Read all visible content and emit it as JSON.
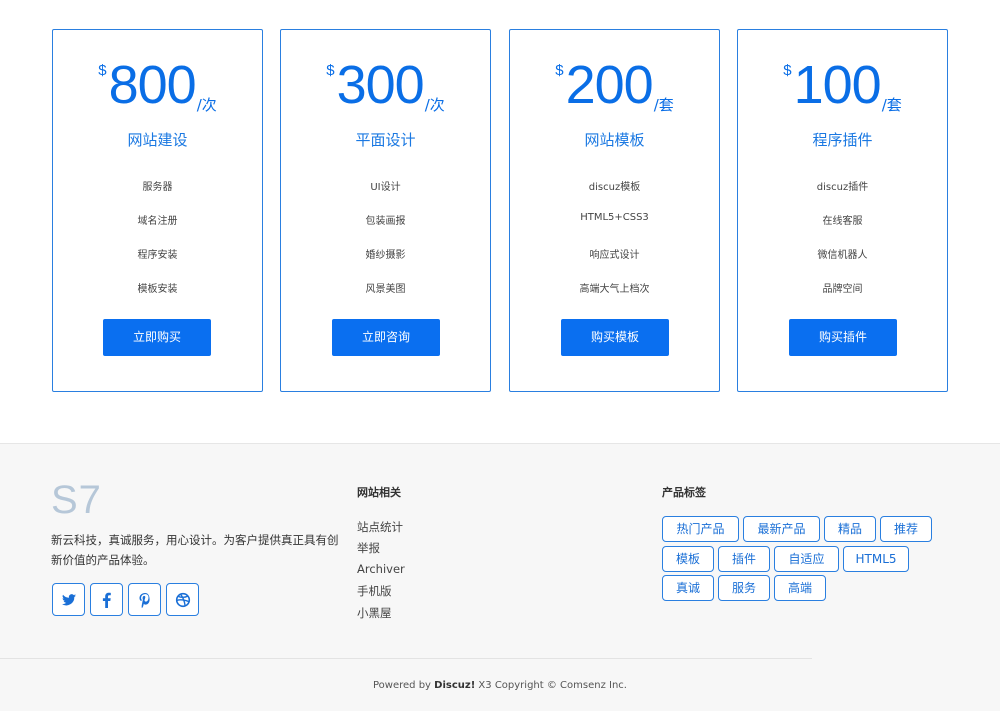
{
  "plans": [
    {
      "currency": "$",
      "amount": "800",
      "unit": "/次",
      "title": "网站建设",
      "features": [
        "服务器",
        "域名注册",
        "程序安装",
        "模板安装"
      ],
      "button": "立即购买"
    },
    {
      "currency": "$",
      "amount": "300",
      "unit": "/次",
      "title": "平面设计",
      "features": [
        "UI设计",
        "包装画报",
        "婚纱摄影",
        "风景美图"
      ],
      "button": "立即咨询"
    },
    {
      "currency": "$",
      "amount": "200",
      "unit": "/套",
      "title": "网站模板",
      "features": [
        "discuz模板",
        "HTML5+CSS3",
        "响应式设计",
        "高端大气上档次"
      ],
      "button": "购买模板"
    },
    {
      "currency": "$",
      "amount": "100",
      "unit": "/套",
      "title": "程序插件",
      "features": [
        "discuz插件",
        "在线客服",
        "微信机器人",
        "品牌空间"
      ],
      "button": "购买插件"
    }
  ],
  "footer": {
    "logo": "S7",
    "description": "新云科技，真诚服务，用心设计。为客户提供真正具有创新价值的产品体验。",
    "social_icons": [
      "twitter-icon",
      "facebook-icon",
      "pinterest-icon",
      "dribbble-icon"
    ],
    "links_title": "网站相关",
    "links": [
      "站点统计",
      "举报",
      "Archiver",
      "手机版",
      "小黑屋"
    ],
    "tags_title": "产品标签",
    "tags": [
      "热门产品",
      "最新产品",
      "精品",
      "推荐",
      "模板",
      "插件",
      "自适应",
      "HTML5",
      "真诚",
      "服务",
      "高端"
    ],
    "copyright_prefix": "Powered by ",
    "copyright_brand": "Discuz!",
    "copyright_suffix": " X3 Copyright © Comsenz Inc."
  },
  "colors": {
    "accent": "#0a6ff0",
    "border": "#2a7fe0",
    "footer_bg": "#f7f7f7"
  }
}
